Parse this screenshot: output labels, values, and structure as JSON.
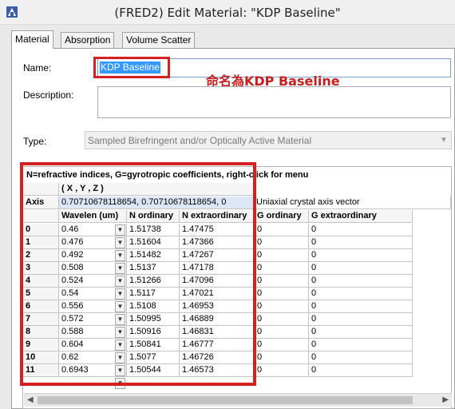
{
  "window": {
    "title": "(FRED2) Edit Material: \"KDP Baseline\""
  },
  "tabs": [
    {
      "label": "Material",
      "active": true
    },
    {
      "label": "Absorption",
      "active": false
    },
    {
      "label": "Volume Scatter",
      "active": false
    }
  ],
  "form": {
    "name_label": "Name:",
    "name_value": "KDP Baseline",
    "annotation": "命名為KDP Baseline",
    "description_label": "Description:",
    "description_value": "",
    "type_label": "Type:",
    "type_value": "Sampled Birefringent and/or Optically Active Material"
  },
  "grid": {
    "header": "N=refractive indices,  G=gyrotropic coefficients,  right-click for menu",
    "axis_header": "( X , Y , Z )",
    "axis_label": "Axis",
    "axis_value": "0.70710678118654,  0.70710678118654,  0",
    "axis_desc": "Uniaxial crystal axis vector",
    "columns": [
      "Wavelen (um)",
      "N ordinary",
      "N extraordinary",
      "G ordinary",
      "G extraordinary"
    ],
    "rows": [
      {
        "idx": "0",
        "wl": "0.46",
        "no": "1.51738",
        "ne": "1.47475",
        "go": "0",
        "ge": "0"
      },
      {
        "idx": "1",
        "wl": "0.476",
        "no": "1.51604",
        "ne": "1.47366",
        "go": "0",
        "ge": "0"
      },
      {
        "idx": "2",
        "wl": "0.492",
        "no": "1.51482",
        "ne": "1.47267",
        "go": "0",
        "ge": "0"
      },
      {
        "idx": "3",
        "wl": "0.508",
        "no": "1.5137",
        "ne": "1.47178",
        "go": "0",
        "ge": "0"
      },
      {
        "idx": "4",
        "wl": "0.524",
        "no": "1.51266",
        "ne": "1.47096",
        "go": "0",
        "ge": "0"
      },
      {
        "idx": "5",
        "wl": "0.54",
        "no": "1.5117",
        "ne": "1.47021",
        "go": "0",
        "ge": "0"
      },
      {
        "idx": "6",
        "wl": "0.556",
        "no": "1.5108",
        "ne": "1.46953",
        "go": "0",
        "ge": "0"
      },
      {
        "idx": "7",
        "wl": "0.572",
        "no": "1.50995",
        "ne": "1.46889",
        "go": "0",
        "ge": "0"
      },
      {
        "idx": "8",
        "wl": "0.588",
        "no": "1.50916",
        "ne": "1.46831",
        "go": "0",
        "ge": "0"
      },
      {
        "idx": "9",
        "wl": "0.604",
        "no": "1.50841",
        "ne": "1.46777",
        "go": "0",
        "ge": "0"
      },
      {
        "idx": "10",
        "wl": "0.62",
        "no": "1.5077",
        "ne": "1.46726",
        "go": "0",
        "ge": "0"
      },
      {
        "idx": "11",
        "wl": "0.6943",
        "no": "1.50544",
        "ne": "1.46573",
        "go": "0",
        "ge": "0"
      }
    ]
  },
  "colors": {
    "highlight_red": "#d42020",
    "selection_blue": "#3399ff"
  }
}
